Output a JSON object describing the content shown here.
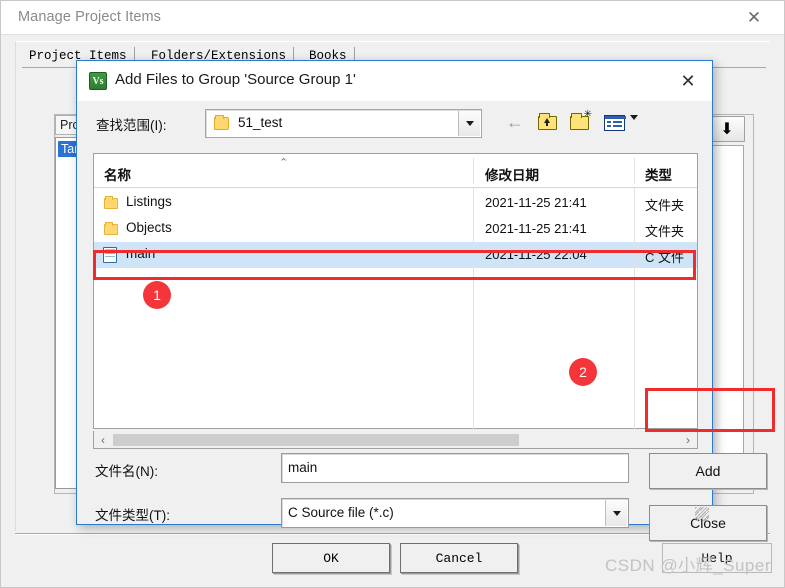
{
  "manage_window": {
    "title": "Manage Project Items",
    "close_icon": "✕",
    "tabs": [
      {
        "label": "Project Items"
      },
      {
        "label": "Folders/Extensions"
      },
      {
        "label": "Books"
      }
    ],
    "project_label": "Project",
    "project_tree_item": "Target",
    "arrow_button_icon": "⬇",
    "buttons": {
      "ok": "OK",
      "cancel": "Cancel",
      "help": "Help"
    }
  },
  "add_dialog": {
    "title": "Add Files to Group 'Source Group 1'",
    "icon_label": "Vs",
    "close_icon": "✕",
    "lookin": {
      "label": "查找范围(I):",
      "value": "51_test",
      "dropdown_icon": "chevron-down-icon"
    },
    "toolbar": [
      {
        "name": "back-icon",
        "glyph": "←"
      },
      {
        "name": "up-one-level-icon"
      },
      {
        "name": "new-folder-icon"
      },
      {
        "name": "views-icon"
      }
    ],
    "filelist": {
      "columns": [
        "名称",
        "修改日期",
        "类型"
      ],
      "sort_indicator": "⌃",
      "rows": [
        {
          "icon": "folder-icon",
          "name": "Listings",
          "date": "2021-11-25 21:41",
          "type": "文件夹",
          "selected": false
        },
        {
          "icon": "folder-icon",
          "name": "Objects",
          "date": "2021-11-25 21:41",
          "type": "文件夹",
          "selected": false
        },
        {
          "icon": "c-file-icon",
          "name": "main",
          "date": "2021-11-25 22:04",
          "type": "C 文件",
          "selected": true
        }
      ]
    },
    "hscroll": {
      "left_icon": "‹",
      "right_icon": "›"
    },
    "filename": {
      "label": "文件名(N):",
      "value": "main"
    },
    "filetype": {
      "label": "文件类型(T):",
      "value": "C Source file (*.c)"
    },
    "buttons": {
      "add": "Add",
      "close": "Close"
    }
  },
  "annotations": {
    "badges": [
      {
        "id": "1",
        "text": "1"
      },
      {
        "id": "2",
        "text": "2"
      }
    ],
    "highlight_color": "#ef2b2b",
    "badge_color": "#f4353a"
  },
  "watermark": "CSDN @小辉_Super"
}
